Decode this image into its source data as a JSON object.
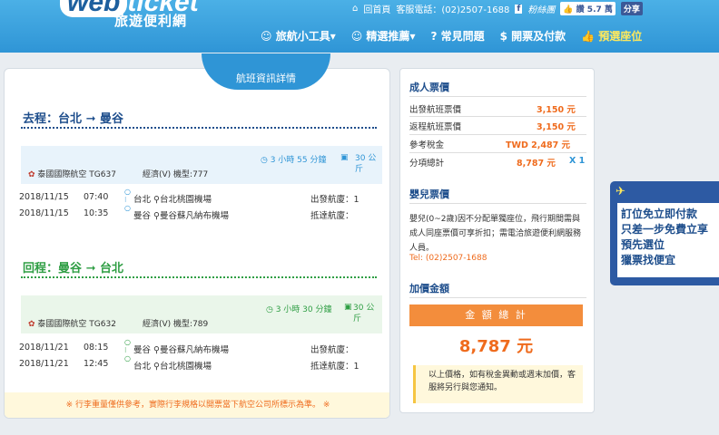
{
  "header": {
    "logo_web": "web",
    "logo_ticket": "ticket",
    "logo_sub": "旅遊便利網",
    "home_link": "回首頁",
    "phone": "客服電話：(02)2507-1688",
    "fb_text": "粉絲團",
    "like_label": "讚 5.7 萬",
    "share_label": "分享",
    "nav": [
      "旅航小工具",
      "精選推薦",
      "常見問題",
      "開票及付款",
      "預選座位"
    ]
  },
  "colors": {
    "brand_blue": "#2f95d6",
    "accent_orange": "#ef6b1d",
    "nav_highlight": "#ffe95c",
    "outbound_green": "#2f9e44"
  },
  "left": {
    "tab_title": "航班資訊詳情",
    "outbound": {
      "title": "去程：",
      "from": "台北",
      "arrow": "➞",
      "to": "曼谷",
      "airline": "泰國國際航空 TG637",
      "class_plane": "經濟(V) 機型:777",
      "duration": "3 小時 55 分鐘",
      "baggage": "30 公斤",
      "depart": {
        "date": "2018/11/15",
        "time": "07:40",
        "city": "台北",
        "airport": "台北桃園機場",
        "term_label": "出發航廈：",
        "term": "1"
      },
      "arrive": {
        "date": "2018/11/15",
        "time": "10:35",
        "city": "曼谷",
        "airport": "曼谷蘇凡納布機場",
        "term_label": "抵達航廈：",
        "term": ""
      }
    },
    "inbound": {
      "title": "回程：",
      "from": "曼谷",
      "arrow": "➞",
      "to": "台北",
      "airline": "泰國國際航空 TG632",
      "class_plane": "經濟(V) 機型:789",
      "duration": "3 小時 30 分鐘",
      "baggage": "30 公斤",
      "depart": {
        "date": "2018/11/21",
        "time": "08:15",
        "city": "曼谷",
        "airport": "曼谷蘇凡納布機場",
        "term_label": "出發航廈：",
        "term": ""
      },
      "arrive": {
        "date": "2018/11/21",
        "time": "12:45",
        "city": "台北",
        "airport": "台北桃園機場",
        "term_label": "抵達航廈：",
        "term": "1"
      }
    },
    "bottom_note": "※ 行李重量僅供參考，實際行李規格以開票當下航空公司所標示為準。 ※"
  },
  "right": {
    "adult_title": "成人票價",
    "rows": [
      {
        "label": "出發航班票價",
        "value": "3,150 元"
      },
      {
        "label": "返程航班票價",
        "value": "3,150 元"
      },
      {
        "label": "參考稅金",
        "value": "TWD 2,487 元"
      },
      {
        "label": "分項總計",
        "value": "8,787 元",
        "mult": "X 1"
      }
    ],
    "infant_title": "嬰兒票價",
    "infant_text": "嬰兒(0~2歲)因不分配單獨座位，飛行期間需與成人同座票價可享折扣；需電洽旅遊便利網服務人員。",
    "infant_tel": "Tel: (02)2507-1688",
    "extra_title": "加價金額",
    "total_label": "金 額 總 計",
    "total_value": "8,787 元",
    "note": "以上價格，如有稅金異動或週末加價，客服將另行與您通知。"
  },
  "promo": {
    "lines": [
      "訂位免立即付款",
      "只差一步免費立享",
      "預先選位",
      "獵票找便宜"
    ]
  }
}
